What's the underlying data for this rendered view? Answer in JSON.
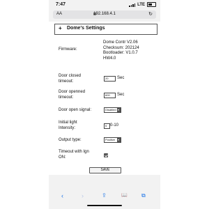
{
  "status_bar": {
    "time": "7:47",
    "network": "LTE"
  },
  "browser": {
    "text_size_label": "AA",
    "url": "192.168.4.1",
    "reload_glyph": "↻"
  },
  "page": {
    "title": "Dome's Settings",
    "expand_glyph": "+",
    "firmware": {
      "label": "Firmware:",
      "lines": [
        "Dome Contr V2.06",
        "Checksum: 202124",
        "Bootloader: V1.0.7",
        "HW4.0"
      ]
    },
    "door_closed_timeout": {
      "label_lines": [
        "Door closed",
        "timeout:"
      ],
      "value": "20",
      "unit": "Sec"
    },
    "door_opened_timeout": {
      "label_lines": [
        "Door openned",
        "timeout:"
      ],
      "value": "600",
      "unit": "Sec"
    },
    "door_open_signal": {
      "label": "Door open signal:",
      "selected": "Disabled"
    },
    "initial_light_intensity": {
      "label_lines": [
        "Initial light",
        "Intensity:"
      ],
      "value": "5",
      "range": "0-10"
    },
    "output_type": {
      "label": "Output type:",
      "selected": "Positive"
    },
    "timeout_with_ign_on": {
      "label_lines": [
        "Timeout with Ign",
        "ON:"
      ],
      "checked": true
    },
    "save_label": "SAVE"
  },
  "toolbar": {
    "back": "‹",
    "forward": "›",
    "share": "⇪",
    "bookmarks": "📖",
    "tabs": "⧉"
  }
}
